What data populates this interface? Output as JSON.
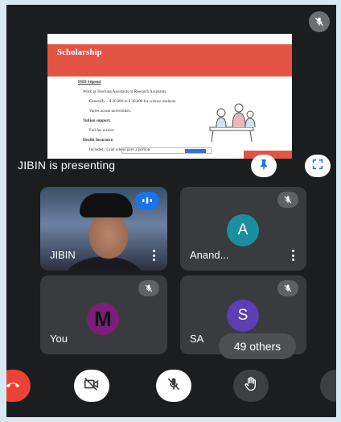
{
  "presentation": {
    "slide": {
      "title": "Scholarship",
      "lines": [
        "PHD Stipend",
        "Work as Teaching Assistants or Research Assistants.",
        "Generally ~ $ 20,000 to $ 30,000 for science students.",
        "Varies across universities.",
        "Tuition support.",
        "Full fee waiver.",
        "Health Insurance.",
        "Included / Grad school pays a portion."
      ]
    },
    "presenting_label": "JIBIN is presenting"
  },
  "tiles": [
    {
      "name": "JIBIN",
      "has_video": true
    },
    {
      "name": "Anand...",
      "avatar_letter": "A",
      "avatar_color": "#1a8fa0"
    },
    {
      "name": "You",
      "avatar_letter": "M",
      "avatar_color": "#7b1f7a"
    },
    {
      "name": "SA",
      "avatar_letter": "S",
      "avatar_color": "#5b3fb3"
    }
  ],
  "others_badge": "49 others",
  "controls": {
    "end_call_color": "#ea4335",
    "icons": [
      "end-call-icon",
      "camera-off-icon",
      "mic-off-icon",
      "raise-hand-icon",
      "more-options-icon"
    ]
  }
}
